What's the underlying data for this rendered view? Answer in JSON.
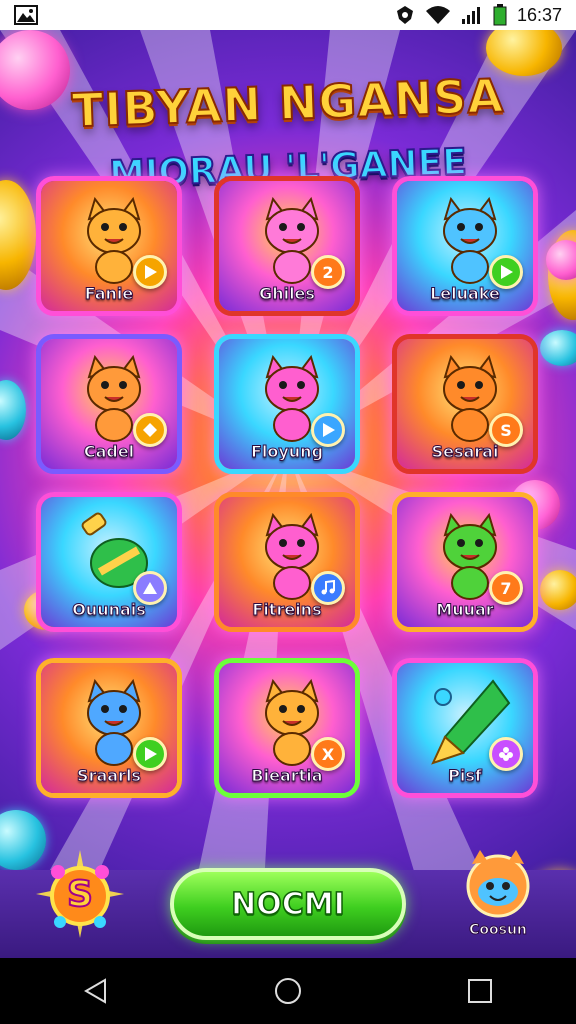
{
  "status_bar": {
    "time": "16:37",
    "icons": [
      "gallery-icon",
      "vpn-shield-icon",
      "wifi-icon",
      "signal-icon",
      "battery-icon"
    ]
  },
  "header": {
    "title": "TIBYAN NGANSA",
    "subtitle": "MIORAU 'L'GANEE"
  },
  "levels": [
    {
      "label": "Fanie",
      "badge_icon": "play-arrow",
      "badge": "",
      "badge_color": "#f6a400",
      "frame_color": "#ff4fd8",
      "creature": "cat"
    },
    {
      "label": "Ghiles",
      "badge_icon": "",
      "badge": "2",
      "badge_color": "#ff7a1a",
      "frame_color": "#e0352a",
      "creature": "cat"
    },
    {
      "label": "Leluake",
      "badge_icon": "play-arrow",
      "badge": "",
      "badge_color": "#3fcf20",
      "frame_color": "#ff4fd8",
      "creature": "cat"
    },
    {
      "label": "Cadel",
      "badge_icon": "diamond",
      "badge": "",
      "badge_color": "#f6a400",
      "frame_color": "#7a5bff",
      "creature": "cat"
    },
    {
      "label": "Floyung",
      "badge_icon": "play-arrow",
      "badge": "",
      "badge_color": "#3aa6ff",
      "frame_color": "#3ad7ff",
      "creature": "cat"
    },
    {
      "label": "Sesarai",
      "badge_icon": "",
      "badge": "S",
      "badge_color": "#ff7a1a",
      "frame_color": "#e0352a",
      "creature": "cat"
    },
    {
      "label": "Ouunais",
      "badge_icon": "triangle",
      "badge": "",
      "badge_color": "#8a7cff",
      "frame_color": "#ff4fd8",
      "creature": "potion"
    },
    {
      "label": "Fitreins",
      "badge_icon": "music-note",
      "badge": "",
      "badge_color": "#3a7cff",
      "frame_color": "#ff8a2a",
      "creature": "cat"
    },
    {
      "label": "Muuar",
      "badge_icon": "",
      "badge": "7",
      "badge_color": "#ff7a1a",
      "frame_color": "#ffb02a",
      "creature": "cat"
    },
    {
      "label": "Sraarls",
      "badge_icon": "play-arrow",
      "badge": "",
      "badge_color": "#3fcf20",
      "frame_color": "#ffb02a",
      "creature": "cat"
    },
    {
      "label": "Bieartia",
      "badge_icon": "",
      "badge": "X",
      "badge_color": "#ff7a1a",
      "frame_color": "#6cff3a",
      "creature": "cat"
    },
    {
      "label": "Pisf",
      "badge_icon": "flower",
      "badge": "",
      "badge_color": "#c84fff",
      "frame_color": "#ff4fd8",
      "creature": "drill"
    }
  ],
  "bottom": {
    "bonus_label": "S",
    "play_label": "NOCMI",
    "profile_label": "Coosun"
  },
  "nav": [
    "back-icon",
    "home-icon",
    "recents-icon"
  ]
}
